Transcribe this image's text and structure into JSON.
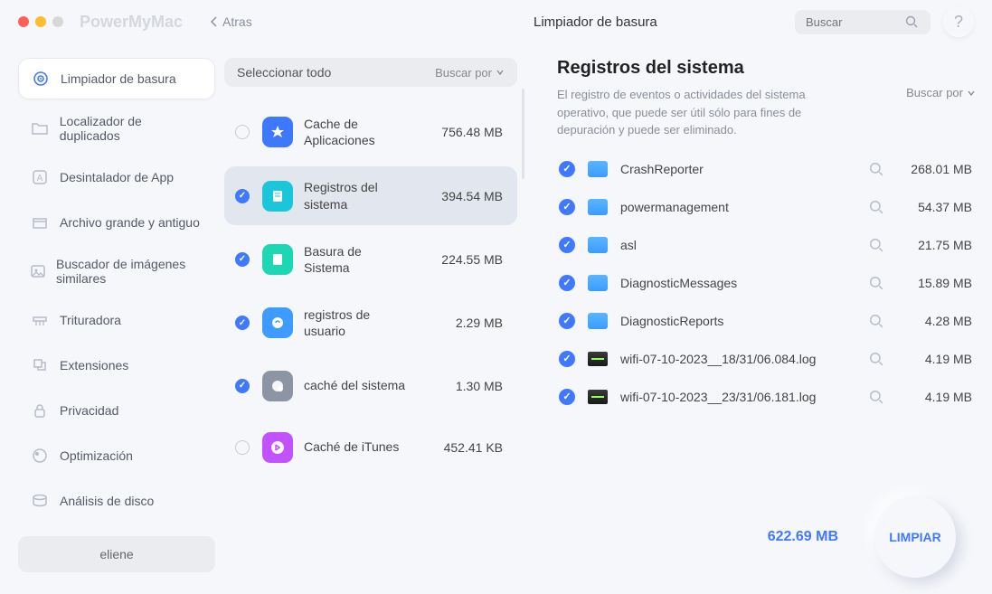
{
  "app_title": "PowerMyMac",
  "back_label": "Atras",
  "header_title": "Limpiador de basura",
  "search_placeholder": "Buscar",
  "help_label": "?",
  "sidebar": {
    "items": [
      {
        "label": "Limpiador de basura",
        "icon": "target-icon",
        "active": true
      },
      {
        "label": "Localizador de duplicados",
        "icon": "folder-icon",
        "active": false
      },
      {
        "label": "Desintalador de App",
        "icon": "app-icon",
        "active": false
      },
      {
        "label": "Archivo grande y antiguo",
        "icon": "box-icon",
        "active": false
      },
      {
        "label": "Buscador de imágenes similares",
        "icon": "image-icon",
        "active": false
      },
      {
        "label": "Trituradora",
        "icon": "shredder-icon",
        "active": false
      },
      {
        "label": "Extensiones",
        "icon": "puzzle-icon",
        "active": false
      },
      {
        "label": "Privacidad",
        "icon": "lock-icon",
        "active": false
      },
      {
        "label": "Optimización",
        "icon": "rocket-icon",
        "active": false
      },
      {
        "label": "Análisis de disco",
        "icon": "disk-icon",
        "active": false
      }
    ],
    "user": "eliene"
  },
  "midcol": {
    "select_all": "Seleccionar todo",
    "search_by": "Buscar por",
    "categories": [
      {
        "name": "Cache de Aplicaciones",
        "size": "756.48 MB",
        "checked": false,
        "color": "#3e78ff"
      },
      {
        "name": "Registros del sistema",
        "size": "394.54 MB",
        "checked": true,
        "color": "#1bc6d9",
        "active": true
      },
      {
        "name": "Basura de Sistema",
        "size": "224.55 MB",
        "checked": true,
        "color": "#1dd6b4"
      },
      {
        "name": "registros de usuario",
        "size": "2.29 MB",
        "checked": true,
        "color": "#3e9bff"
      },
      {
        "name": "caché del sistema",
        "size": "1.30 MB",
        "checked": true,
        "color": "#8d95a5"
      },
      {
        "name": "Caché de iTunes",
        "size": "452.41 KB",
        "checked": false,
        "color": "#c252ff"
      }
    ]
  },
  "detail": {
    "title": "Registros del sistema",
    "description": "El registro de eventos o actividades del sistema operativo, que puede ser útil sólo para fines de depuración y puede ser eliminado.",
    "search_by": "Buscar por",
    "files": [
      {
        "name": "CrashReporter",
        "size": "268.01 MB",
        "type": "folder"
      },
      {
        "name": "powermanagement",
        "size": "54.37 MB",
        "type": "folder"
      },
      {
        "name": "asl",
        "size": "21.75 MB",
        "type": "folder"
      },
      {
        "name": "DiagnosticMessages",
        "size": "15.89 MB",
        "type": "folder"
      },
      {
        "name": "DiagnosticReports",
        "size": "4.28 MB",
        "type": "folder"
      },
      {
        "name": "wifi-07-10-2023__18/31/06.084.log",
        "size": "4.19 MB",
        "type": "file"
      },
      {
        "name": "wifi-07-10-2023__23/31/06.181.log",
        "size": "4.19 MB",
        "type": "file"
      }
    ]
  },
  "footer": {
    "total": "622.69 MB",
    "clean": "LIMPIAR"
  }
}
